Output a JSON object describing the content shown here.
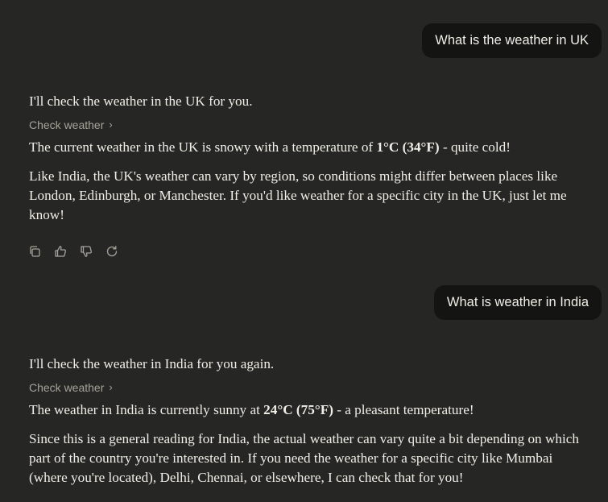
{
  "messages": [
    {
      "user": "What is the weather in UK",
      "assistant": {
        "intro": "I'll check the weather in the UK for you.",
        "tool_label": "Check weather",
        "result_pre": "The current weather in the UK is snowy with a temperature of ",
        "result_bold": "1°C (34°F)",
        "result_post": " - quite cold!",
        "detail": "Like India, the UK's weather can vary by region, so conditions might differ between places like London, Edinburgh, or Manchester. If you'd like weather for a specific city in the UK, just let me know!"
      }
    },
    {
      "user": "What is weather in India",
      "assistant": {
        "intro": "I'll check the weather in India for you again.",
        "tool_label": "Check weather",
        "result_pre": "The weather in India is currently sunny at ",
        "result_bold": "24°C (75°F)",
        "result_post": " - a pleasant temperature!",
        "detail": "Since this is a general reading for India, the actual weather can vary quite a bit depending on which part of the country you're interested in. If you need the weather for a specific city like Mumbai (where you're located), Delhi, Chennai, or elsewhere, I can check that for you!"
      }
    }
  ],
  "actions": [
    "copy-icon",
    "thumbs-up-icon",
    "thumbs-down-icon",
    "retry-icon"
  ],
  "colors": {
    "background": "#262624",
    "bubble": "#141413",
    "text": "#f0eee6",
    "muted": "#a6a39a"
  }
}
